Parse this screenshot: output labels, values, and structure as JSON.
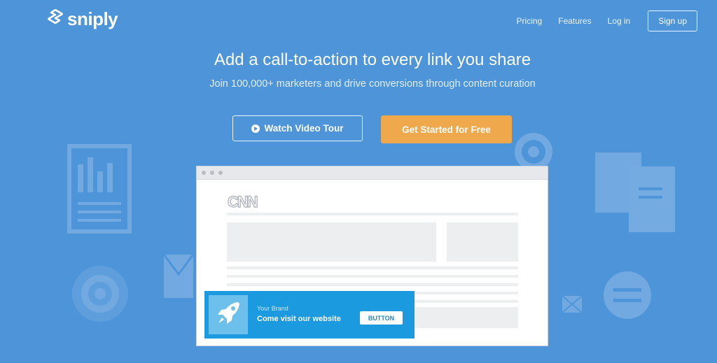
{
  "header": {
    "logo_text": "sniply",
    "nav": [
      {
        "label": "Pricing"
      },
      {
        "label": "Features"
      },
      {
        "label": "Log in"
      }
    ],
    "signup_label": "Sign up"
  },
  "hero": {
    "headline": "Add a call-to-action to every link you share",
    "subheadline": "Join 100,000+ marketers and drive conversions through content curation",
    "video_button_label": "Watch Video Tour",
    "start_button_label": "Get Started for Free"
  },
  "demo": {
    "site_logo_text": "CNN",
    "cta": {
      "brand": "Your Brand",
      "message": "Come visit our website",
      "button_label": "BUTTON"
    }
  },
  "colors": {
    "background": "#4d94d9",
    "accent_orange": "#f0a84c",
    "cta_blue": "#1b9ae0"
  },
  "icons": [
    "sniply-logo-icon",
    "play-icon",
    "rocket-icon",
    "document-chart-icon",
    "gear-icon",
    "envelope-icon",
    "documents-icon",
    "swap-arrows-icon"
  ]
}
